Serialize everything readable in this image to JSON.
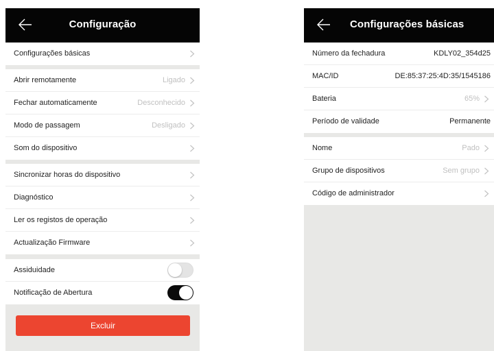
{
  "colors": {
    "header_bg": "#050505",
    "page_bg": "#e8e8e6",
    "danger": "#ec4530",
    "muted_text": "#c0c0c0",
    "toggle_on": "#0b0b0b"
  },
  "icons": {
    "back": "arrow-left-icon",
    "chevron": "chevron-right-icon"
  },
  "left": {
    "title": "Configuração",
    "group1": [
      {
        "label": "Configurações básicas",
        "value": ""
      }
    ],
    "group2": [
      {
        "label": "Abrir remotamente",
        "value": "Ligado"
      },
      {
        "label": "Fechar automaticamente",
        "value": "Desconhecido"
      },
      {
        "label": "Modo de passagem",
        "value": "Desligado"
      },
      {
        "label": "Som do dispositivo",
        "value": ""
      }
    ],
    "group3": [
      {
        "label": "Sincronizar horas do dispositivo",
        "value": ""
      },
      {
        "label": "Diagnóstico",
        "value": ""
      },
      {
        "label": "Ler os registos de operação",
        "value": ""
      },
      {
        "label": "Actualização Firmware",
        "value": ""
      }
    ],
    "toggles": [
      {
        "label": "Assiduidade",
        "state": "off"
      },
      {
        "label": "Notificação de Abertura",
        "state": "on"
      }
    ],
    "delete_label": "Excluir"
  },
  "right": {
    "title": "Configurações básicas",
    "group1": [
      {
        "label": "Número da fechadura",
        "value": "KDLY02_354d25"
      },
      {
        "label": "MAC/ID",
        "value": "DE:85:37:25:4D:35/1545186"
      },
      {
        "label": "Bateria",
        "value": "65%"
      },
      {
        "label": "Período de validade",
        "value": "Permanente"
      }
    ],
    "group2": [
      {
        "label": "Nome",
        "value": "Pado"
      },
      {
        "label": "Grupo de dispositivos",
        "value": "Sem grupo"
      },
      {
        "label": "Código de administrador",
        "value": ""
      }
    ]
  }
}
